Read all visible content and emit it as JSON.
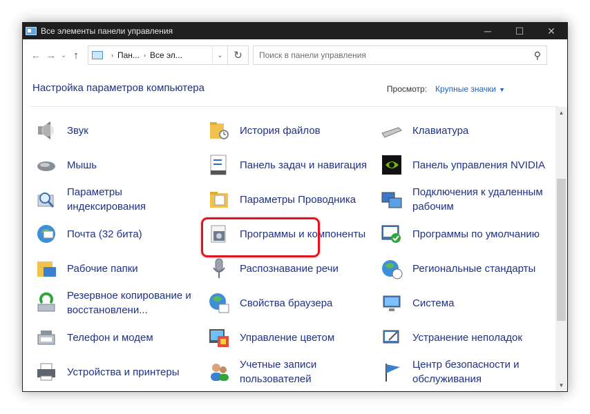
{
  "window": {
    "title": "Все элементы панели управления"
  },
  "titlebar": {
    "minimize": "─",
    "maximize": "☐",
    "close": "✕"
  },
  "nav": {
    "back": "←",
    "forward": "→",
    "recent": "⌄",
    "up": "↑",
    "refresh": "↻"
  },
  "address": {
    "crumbs": [
      "Пан...",
      "Все эл..."
    ],
    "separator": "›"
  },
  "search": {
    "placeholder": "Поиск в панели управления",
    "value": ""
  },
  "header": {
    "title": "Настройка параметров компьютера",
    "view_label": "Просмотр:",
    "view_value": "Крупные значки"
  },
  "items": [
    {
      "label": "Звук",
      "icon": "speaker-icon"
    },
    {
      "label": "История файлов",
      "icon": "file-history-icon"
    },
    {
      "label": "Клавиатура",
      "icon": "keyboard-icon"
    },
    {
      "label": "Мышь",
      "icon": "mouse-icon"
    },
    {
      "label": "Панель задач и навигация",
      "icon": "taskbar-icon"
    },
    {
      "label": "Панель управления NVIDIA",
      "icon": "nvidia-icon"
    },
    {
      "label": "Параметры индексирования",
      "icon": "indexing-icon"
    },
    {
      "label": "Параметры Проводника",
      "icon": "folder-options-icon"
    },
    {
      "label": "Подключения к удаленным рабочим",
      "icon": "remote-desktop-icon"
    },
    {
      "label": "Почта (32 бита)",
      "icon": "mail-icon"
    },
    {
      "label": "Программы и компоненты",
      "icon": "programs-icon"
    },
    {
      "label": "Программы по умолчанию",
      "icon": "default-programs-icon"
    },
    {
      "label": "Рабочие папки",
      "icon": "work-folders-icon"
    },
    {
      "label": "Распознавание речи",
      "icon": "microphone-icon"
    },
    {
      "label": "Региональные стандарты",
      "icon": "region-icon"
    },
    {
      "label": "Резервное копирование и восстановлени...",
      "icon": "backup-icon"
    },
    {
      "label": "Свойства браузера",
      "icon": "internet-options-icon"
    },
    {
      "label": "Система",
      "icon": "system-icon"
    },
    {
      "label": "Телефон и модем",
      "icon": "phone-modem-icon"
    },
    {
      "label": "Управление цветом",
      "icon": "color-management-icon"
    },
    {
      "label": "Устранение неполадок",
      "icon": "troubleshooting-icon"
    },
    {
      "label": "Устройства и принтеры",
      "icon": "printer-icon"
    },
    {
      "label": "Учетные записи пользователей",
      "icon": "user-accounts-icon"
    },
    {
      "label": "Центр безопасности и обслуживания",
      "icon": "security-flag-icon"
    }
  ],
  "colors": {
    "link": "#1e3287",
    "accent": "#1f62b8",
    "highlight": "#e0141e",
    "titlebar": "#1f1f1f"
  }
}
